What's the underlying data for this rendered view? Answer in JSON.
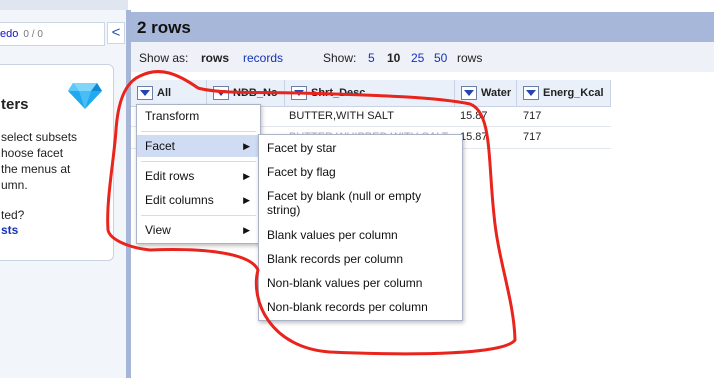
{
  "sidebar": {
    "undo_label": "edo",
    "undo_count": "0 / 0",
    "collapse_glyph": "<",
    "card_title": "ters",
    "card_lines": [
      "select subsets",
      "hoose facet",
      "the menus at",
      "umn."
    ],
    "card_question": "ted?",
    "card_link": "sts",
    "card_icon": "diamond-icon"
  },
  "header": {
    "title": "2 rows"
  },
  "viewbar": {
    "show_as_label": "Show as:",
    "mode_rows": "rows",
    "mode_records": "records",
    "show_label": "Show:",
    "page_sizes": [
      "5",
      "10",
      "25",
      "50"
    ],
    "selected_page_size": "10",
    "rows_suffix": "rows"
  },
  "table": {
    "columns": [
      "All",
      "NDB_No",
      "Shrt_Desc",
      "Water",
      "Energ_Kcal"
    ],
    "rows": [
      {
        "shrt_desc": "BUTTER,WITH SALT",
        "water": "15.87",
        "energ": "717"
      },
      {
        "shrt_desc": "BUTTER,WHIPPED,WITH SALT",
        "water": "15.87",
        "energ": "717"
      }
    ]
  },
  "all_menu": {
    "items": [
      "Transform",
      "Facet",
      "Edit rows",
      "Edit columns",
      "View"
    ],
    "highlighted": "Facet"
  },
  "facet_menu": {
    "items": [
      "Facet by star",
      "Facet by flag",
      "Facet by blank (null or empty string)",
      "Blank values per column",
      "Blank records per column",
      "Non-blank values per column",
      "Non-blank records per column"
    ]
  },
  "colors": {
    "annotation": "#e8241c",
    "link": "#1533b7",
    "header_bg": "#a7b7d9"
  }
}
